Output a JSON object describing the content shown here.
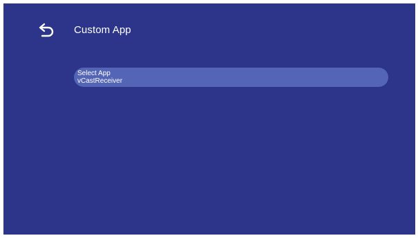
{
  "theme": {
    "background": "#2c3589",
    "highlight": "#5465b6",
    "text": "#ffffff"
  },
  "header": {
    "back_icon": "back-arrow-icon",
    "title": "Custom App"
  },
  "menu": {
    "items": [
      {
        "title": "Select App",
        "value": "vCastReceiver",
        "selected": true
      }
    ]
  }
}
